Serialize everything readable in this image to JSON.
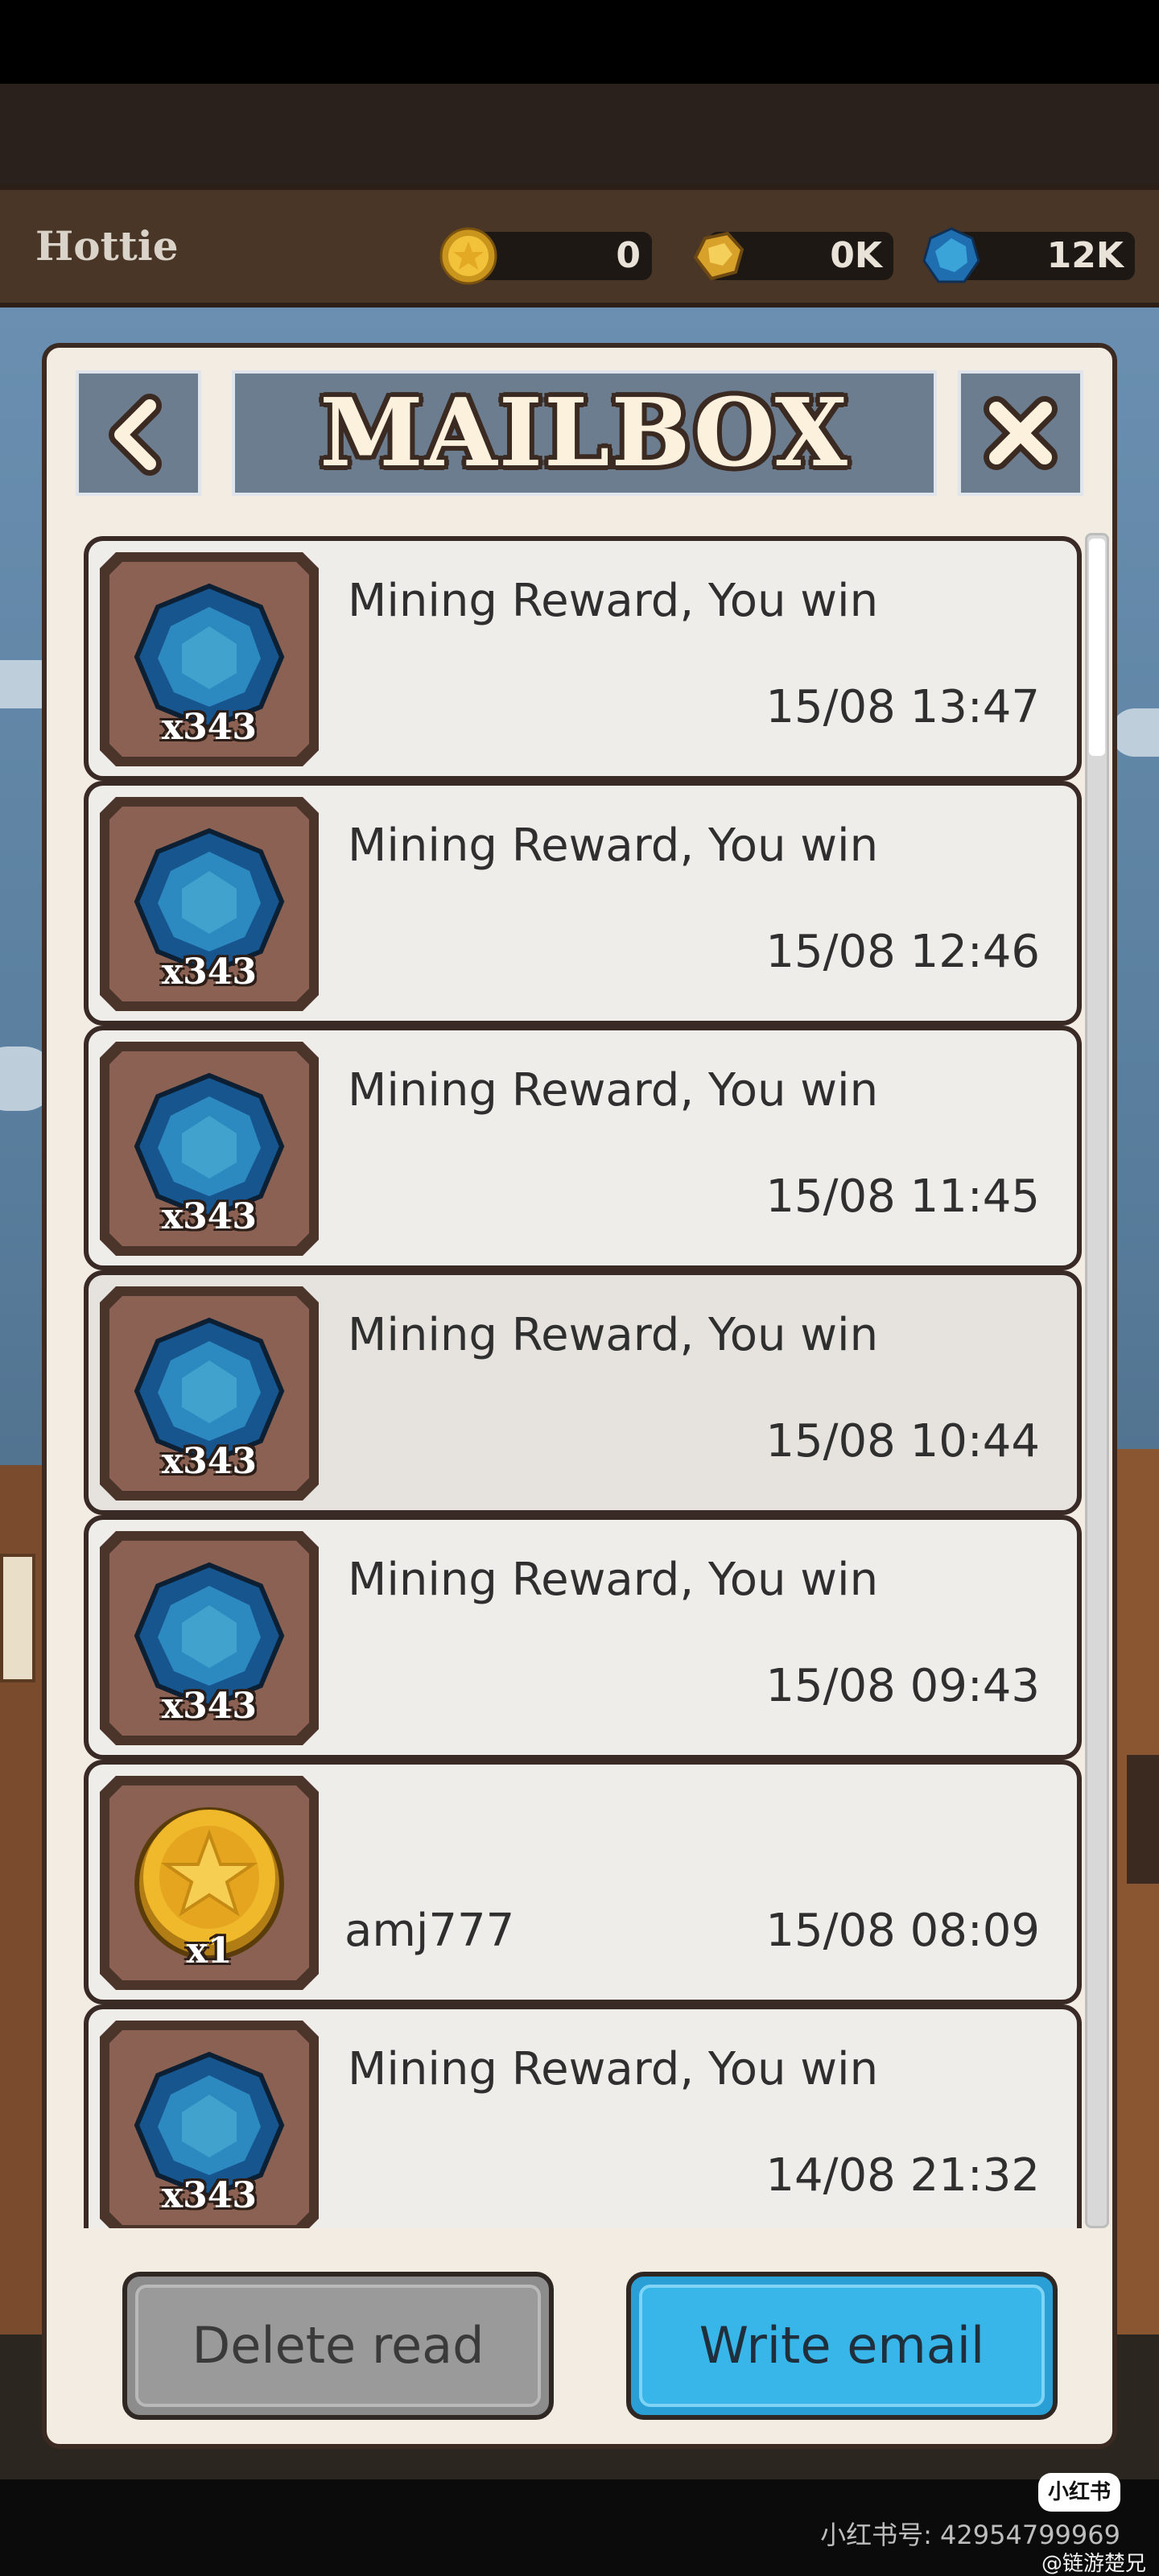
{
  "player": {
    "name": "Hottie"
  },
  "resources": [
    {
      "icon": "gold-coin-icon",
      "value": "0"
    },
    {
      "icon": "gold-ore-icon",
      "value": "0K"
    },
    {
      "icon": "blue-gem-icon",
      "value": "12K"
    }
  ],
  "header": {
    "title": "MAILBOX",
    "back_icon": "chevron-left-icon",
    "close_icon": "close-icon"
  },
  "mails": [
    {
      "reward_icon": "blue-gem-icon",
      "quantity": "x343",
      "subject": "Mining Reward, You win",
      "sender": "",
      "time": "15/08 13:47"
    },
    {
      "reward_icon": "blue-gem-icon",
      "quantity": "x343",
      "subject": "Mining Reward, You win",
      "sender": "",
      "time": "15/08 12:46"
    },
    {
      "reward_icon": "blue-gem-icon",
      "quantity": "x343",
      "subject": "Mining Reward, You win",
      "sender": "",
      "time": "15/08 11:45"
    },
    {
      "reward_icon": "blue-gem-icon",
      "quantity": "x343",
      "subject": "Mining Reward, You win",
      "sender": "",
      "time": "15/08 10:44"
    },
    {
      "reward_icon": "blue-gem-icon",
      "quantity": "x343",
      "subject": "Mining Reward, You win",
      "sender": "",
      "time": "15/08 09:43"
    },
    {
      "reward_icon": "gold-coin-icon",
      "quantity": "x1",
      "subject": "",
      "sender": "amj777",
      "time": "15/08 08:09"
    },
    {
      "reward_icon": "blue-gem-icon",
      "quantity": "x343",
      "subject": "Mining Reward, You win",
      "sender": "",
      "time": "14/08 21:32"
    }
  ],
  "buttons": {
    "delete_read": "Delete read",
    "write_email": "Write email"
  },
  "watermark": {
    "badge": "小红书",
    "id": "小红书号: 4295479​9969",
    "author": "@链游楚兄"
  },
  "colors": {
    "panel_header": "#6b7d8f",
    "write_button": "#38b6ea",
    "delete_button": "#9a9a9a",
    "frame": "#4b3429"
  }
}
